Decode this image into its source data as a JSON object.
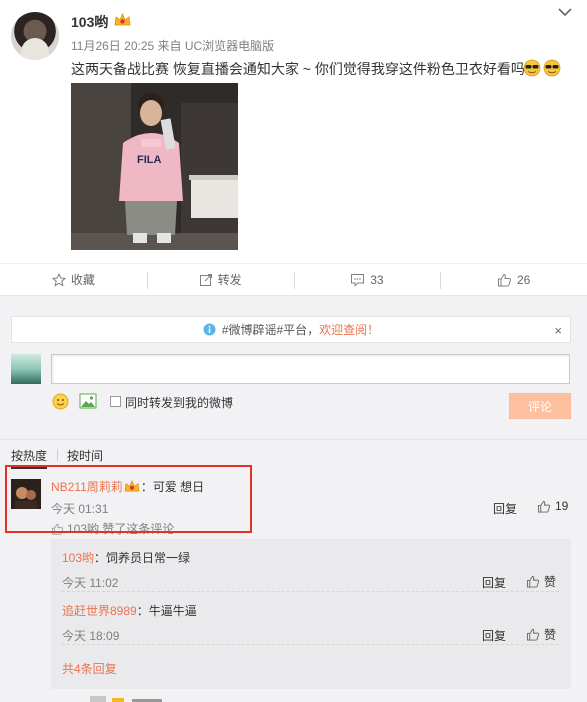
{
  "post": {
    "author": "103哟",
    "meta": "11月26日 20:25 来自 UC浏览器电脑版",
    "text": "这两天备战比赛 恢复直播会通知大家 ~ 你们觉得我穿这件粉色卫衣好看吗",
    "emoji": "cool-sunglasses-face x2",
    "photo": "mirror-selfie-pink-hoodie"
  },
  "actions": {
    "favorite_label": "收藏",
    "repost_label": "转发",
    "comment_count": "33",
    "like_count": "26"
  },
  "notice": {
    "prefix": "#微博辟谣#平台，",
    "link": "欢迎查阅！",
    "close": "×"
  },
  "composer": {
    "input_value": "",
    "repost_option": "同时转发到我的微博",
    "submit_label": "评论"
  },
  "sort": {
    "hot": "按热度",
    "time": "按时间"
  },
  "comments": [
    {
      "name": "NB211周莉莉",
      "text": "：可爱 想日",
      "time": "今天 01:31",
      "reply": "回复",
      "likes": "19",
      "liked_by": "103哟 赞了这条评论"
    }
  ],
  "replies": [
    {
      "name": "103哟",
      "text": "：饲养员日常一绿",
      "time": "今天 11:02",
      "reply": "回复",
      "like": "赞"
    },
    {
      "name": "追赶世界8989",
      "text": "：牛逼牛逼",
      "time": "今天 18:09",
      "reply": "回复",
      "like": "赞"
    }
  ],
  "more_replies": "共4条回复",
  "colors": {
    "accent": "#eb7350",
    "highlight": "#e4322b",
    "submit_disabled": "#ffc09f",
    "comment_bg": "#f2f2f5"
  }
}
